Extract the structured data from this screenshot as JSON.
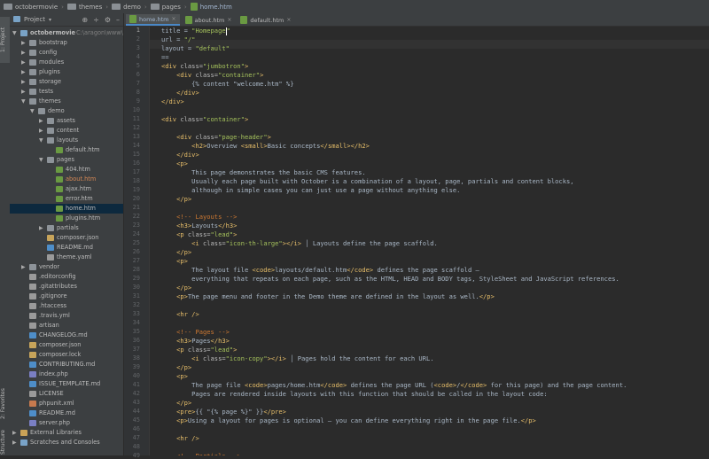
{
  "breadcrumb": [
    {
      "label": "octobermovie",
      "type": "folder"
    },
    {
      "label": "themes",
      "type": "folder"
    },
    {
      "label": "demo",
      "type": "folder"
    },
    {
      "label": "pages",
      "type": "folder"
    },
    {
      "label": "home.htm",
      "type": "file"
    }
  ],
  "side_tabs": {
    "project": "1: Project",
    "favorites": "2: Favorites",
    "structure": "Structure"
  },
  "project_panel": {
    "title": "Project",
    "tools": [
      "settings-icon",
      "collapse-icon",
      "gear-icon",
      "hide-icon"
    ],
    "tree": [
      {
        "label": "octobermovie",
        "suffix": "C:\\aragon\\www\\oc",
        "depth": 0,
        "expanded": true,
        "icon": "module",
        "bold": true
      },
      {
        "label": "bootstrap",
        "depth": 1,
        "expanded": false,
        "icon": "folder"
      },
      {
        "label": "config",
        "depth": 1,
        "expanded": false,
        "icon": "folder"
      },
      {
        "label": "modules",
        "depth": 1,
        "expanded": false,
        "icon": "folder"
      },
      {
        "label": "plugins",
        "depth": 1,
        "expanded": false,
        "icon": "folder"
      },
      {
        "label": "storage",
        "depth": 1,
        "expanded": false,
        "icon": "folder"
      },
      {
        "label": "tests",
        "depth": 1,
        "expanded": false,
        "icon": "folder"
      },
      {
        "label": "themes",
        "depth": 1,
        "expanded": true,
        "icon": "folder"
      },
      {
        "label": "demo",
        "depth": 2,
        "expanded": true,
        "icon": "folder"
      },
      {
        "label": "assets",
        "depth": 3,
        "expanded": false,
        "icon": "folder"
      },
      {
        "label": "content",
        "depth": 3,
        "expanded": false,
        "icon": "folder"
      },
      {
        "label": "layouts",
        "depth": 3,
        "expanded": true,
        "icon": "folder"
      },
      {
        "label": "default.htm",
        "depth": 4,
        "icon": "htm"
      },
      {
        "label": "pages",
        "depth": 3,
        "expanded": true,
        "icon": "folder"
      },
      {
        "label": "404.htm",
        "depth": 4,
        "icon": "htm"
      },
      {
        "label": "about.htm",
        "depth": 4,
        "icon": "htm",
        "style": "orange"
      },
      {
        "label": "ajax.htm",
        "depth": 4,
        "icon": "htm"
      },
      {
        "label": "error.htm",
        "depth": 4,
        "icon": "htm"
      },
      {
        "label": "home.htm",
        "depth": 4,
        "icon": "htm",
        "selected": true
      },
      {
        "label": "plugins.htm",
        "depth": 4,
        "icon": "htm"
      },
      {
        "label": "partials",
        "depth": 3,
        "expanded": false,
        "icon": "folder"
      },
      {
        "label": "composer.json",
        "depth": 3,
        "icon": "json"
      },
      {
        "label": "README.md",
        "depth": 3,
        "icon": "md"
      },
      {
        "label": "theme.yaml",
        "depth": 3,
        "icon": "file"
      },
      {
        "label": "vendor",
        "depth": 1,
        "expanded": false,
        "icon": "folder"
      },
      {
        "label": ".editorconfig",
        "depth": 1,
        "icon": "file"
      },
      {
        "label": ".gitattributes",
        "depth": 1,
        "icon": "file"
      },
      {
        "label": ".gitignore",
        "depth": 1,
        "icon": "file"
      },
      {
        "label": ".htaccess",
        "depth": 1,
        "icon": "file"
      },
      {
        "label": ".travis.yml",
        "depth": 1,
        "icon": "file"
      },
      {
        "label": "artisan",
        "depth": 1,
        "icon": "file"
      },
      {
        "label": "CHANGELOG.md",
        "depth": 1,
        "icon": "md"
      },
      {
        "label": "composer.json",
        "depth": 1,
        "icon": "json"
      },
      {
        "label": "composer.lock",
        "depth": 1,
        "icon": "json"
      },
      {
        "label": "CONTRIBUTING.md",
        "depth": 1,
        "icon": "md"
      },
      {
        "label": "index.php",
        "depth": 1,
        "icon": "php"
      },
      {
        "label": "ISSUE_TEMPLATE.md",
        "depth": 1,
        "icon": "md"
      },
      {
        "label": "LICENSE",
        "depth": 1,
        "icon": "file"
      },
      {
        "label": "phpunit.xml",
        "depth": 1,
        "icon": "xml"
      },
      {
        "label": "README.md",
        "depth": 1,
        "icon": "md"
      },
      {
        "label": "server.php",
        "depth": 1,
        "icon": "php"
      },
      {
        "label": "External Libraries",
        "depth": 0,
        "expanded": false,
        "icon": "lib"
      },
      {
        "label": "Scratches and Consoles",
        "depth": 0,
        "expanded": false,
        "icon": "module"
      }
    ]
  },
  "tabs": [
    {
      "label": "home.htm",
      "active": true
    },
    {
      "label": "about.htm",
      "active": false
    },
    {
      "label": "default.htm",
      "active": false
    }
  ],
  "colors": {
    "tag": "#e8bf6a",
    "attr": "#bababa",
    "string": "#a5c25c",
    "text": "#a9b7c6",
    "comment": "#629755",
    "plain": "#a9b7c6",
    "keyword": "#cc7832",
    "punct": "#cc7832"
  },
  "editor": {
    "current_line": 1,
    "lines": [
      [
        [
          "plain",
          "title = "
        ],
        [
          "string",
          "\"Homepage"
        ],
        [
          "caret",
          ""
        ],
        [
          "string",
          "\""
        ]
      ],
      [
        [
          "plain",
          "url = "
        ],
        [
          "string",
          "\"/\""
        ]
      ],
      [
        [
          "plain",
          "layout = "
        ],
        [
          "string",
          "\"default\""
        ]
      ],
      [
        [
          "plain",
          "=="
        ]
      ],
      [
        [
          "tag",
          "<div "
        ],
        [
          "attr",
          "class="
        ],
        [
          "string",
          "\"jumbotron\""
        ],
        [
          "tag",
          ">"
        ]
      ],
      [
        [
          "plain",
          "    "
        ],
        [
          "tag",
          "<div "
        ],
        [
          "attr",
          "class="
        ],
        [
          "string",
          "\"container\""
        ],
        [
          "tag",
          ">"
        ]
      ],
      [
        [
          "plain",
          "        {% content \"welcome.htm\" %}"
        ]
      ],
      [
        [
          "plain",
          "    "
        ],
        [
          "tag",
          "</div>"
        ]
      ],
      [
        [
          "tag",
          "</div>"
        ]
      ],
      [
        [
          "plain",
          ""
        ]
      ],
      [
        [
          "tag",
          "<div "
        ],
        [
          "attr",
          "class="
        ],
        [
          "string",
          "\"container\""
        ],
        [
          "tag",
          ">"
        ]
      ],
      [
        [
          "plain",
          ""
        ]
      ],
      [
        [
          "plain",
          "    "
        ],
        [
          "tag",
          "<div "
        ],
        [
          "attr",
          "class="
        ],
        [
          "string",
          "\"page-header\""
        ],
        [
          "tag",
          ">"
        ]
      ],
      [
        [
          "plain",
          "        "
        ],
        [
          "tag",
          "<h2>"
        ],
        [
          "text",
          "Overview "
        ],
        [
          "tag",
          "<small>"
        ],
        [
          "text",
          "Basic concepts"
        ],
        [
          "tag",
          "</small></h2>"
        ]
      ],
      [
        [
          "plain",
          "    "
        ],
        [
          "tag",
          "</div>"
        ]
      ],
      [
        [
          "plain",
          "    "
        ],
        [
          "tag",
          "<p>"
        ]
      ],
      [
        [
          "text",
          "        This page demonstrates the basic CMS features."
        ]
      ],
      [
        [
          "text",
          "        Usually each page built with October is a combination of a layout, page, partials and content blocks,"
        ]
      ],
      [
        [
          "text",
          "        although in simple cases you can just use a page without anything else."
        ]
      ],
      [
        [
          "plain",
          "    "
        ],
        [
          "tag",
          "</p>"
        ]
      ],
      [
        [
          "plain",
          ""
        ]
      ],
      [
        [
          "plain",
          "    "
        ],
        [
          "keyword",
          "<!-- Layouts -->"
        ]
      ],
      [
        [
          "plain",
          "    "
        ],
        [
          "tag",
          "<h3>"
        ],
        [
          "text",
          "Layouts"
        ],
        [
          "tag",
          "</h3>"
        ]
      ],
      [
        [
          "plain",
          "    "
        ],
        [
          "tag",
          "<p "
        ],
        [
          "attr",
          "class="
        ],
        [
          "string",
          "\"lead\""
        ],
        [
          "tag",
          ">"
        ]
      ],
      [
        [
          "plain",
          "        "
        ],
        [
          "tag",
          "<i "
        ],
        [
          "attr",
          "class="
        ],
        [
          "string",
          "\"icon-th-large\""
        ],
        [
          "tag",
          "></i>"
        ],
        [
          "text",
          " │ Layouts define the page scaffold."
        ]
      ],
      [
        [
          "plain",
          "    "
        ],
        [
          "tag",
          "</p>"
        ]
      ],
      [
        [
          "plain",
          "    "
        ],
        [
          "tag",
          "<p>"
        ]
      ],
      [
        [
          "text",
          "        The layout file "
        ],
        [
          "tag",
          "<code>"
        ],
        [
          "text",
          "layouts/default.htm"
        ],
        [
          "tag",
          "</code>"
        ],
        [
          "text",
          " defines the page scaffold —"
        ]
      ],
      [
        [
          "text",
          "        everything that repeats on each page, such as the HTML, HEAD and BODY tags, StyleSheet and JavaScript references."
        ]
      ],
      [
        [
          "plain",
          "    "
        ],
        [
          "tag",
          "</p>"
        ]
      ],
      [
        [
          "plain",
          "    "
        ],
        [
          "tag",
          "<p>"
        ],
        [
          "text",
          "The page menu and footer in the Demo theme are defined in the layout as well."
        ],
        [
          "tag",
          "</p>"
        ]
      ],
      [
        [
          "plain",
          ""
        ]
      ],
      [
        [
          "plain",
          "    "
        ],
        [
          "tag",
          "<hr />"
        ]
      ],
      [
        [
          "plain",
          ""
        ]
      ],
      [
        [
          "plain",
          "    "
        ],
        [
          "keyword",
          "<!-- Pages -->"
        ]
      ],
      [
        [
          "plain",
          "    "
        ],
        [
          "tag",
          "<h3>"
        ],
        [
          "text",
          "Pages"
        ],
        [
          "tag",
          "</h3>"
        ]
      ],
      [
        [
          "plain",
          "    "
        ],
        [
          "tag",
          "<p "
        ],
        [
          "attr",
          "class="
        ],
        [
          "string",
          "\"lead\""
        ],
        [
          "tag",
          ">"
        ]
      ],
      [
        [
          "plain",
          "        "
        ],
        [
          "tag",
          "<i "
        ],
        [
          "attr",
          "class="
        ],
        [
          "string",
          "\"icon-copy\""
        ],
        [
          "tag",
          "></i>"
        ],
        [
          "text",
          " │ Pages hold the content for each URL."
        ]
      ],
      [
        [
          "plain",
          "    "
        ],
        [
          "tag",
          "</p>"
        ]
      ],
      [
        [
          "plain",
          "    "
        ],
        [
          "tag",
          "<p>"
        ]
      ],
      [
        [
          "text",
          "        The page file "
        ],
        [
          "tag",
          "<code>"
        ],
        [
          "text",
          "pages/home.htm"
        ],
        [
          "tag",
          "</code>"
        ],
        [
          "text",
          " defines the page URL ("
        ],
        [
          "tag",
          "<code>"
        ],
        [
          "text",
          "/"
        ],
        [
          "tag",
          "</code>"
        ],
        [
          "text",
          " for this page) and the page content."
        ]
      ],
      [
        [
          "text",
          "        Pages are rendered inside layouts with this function that should be called in the layout code:"
        ]
      ],
      [
        [
          "plain",
          "    "
        ],
        [
          "tag",
          "</p>"
        ]
      ],
      [
        [
          "plain",
          "    "
        ],
        [
          "tag",
          "<pre>"
        ],
        [
          "text",
          "{{ \"{% page %}\" }}"
        ],
        [
          "tag",
          "</pre>"
        ]
      ],
      [
        [
          "plain",
          "    "
        ],
        [
          "tag",
          "<p>"
        ],
        [
          "text",
          "Using a layout for pages is optional — you can define everything right in the page file."
        ],
        [
          "tag",
          "</p>"
        ]
      ],
      [
        [
          "plain",
          ""
        ]
      ],
      [
        [
          "plain",
          "    "
        ],
        [
          "tag",
          "<hr />"
        ]
      ],
      [
        [
          "plain",
          ""
        ]
      ],
      [
        [
          "plain",
          "    "
        ],
        [
          "keyword",
          "<!-- Partials -->"
        ]
      ]
    ]
  }
}
